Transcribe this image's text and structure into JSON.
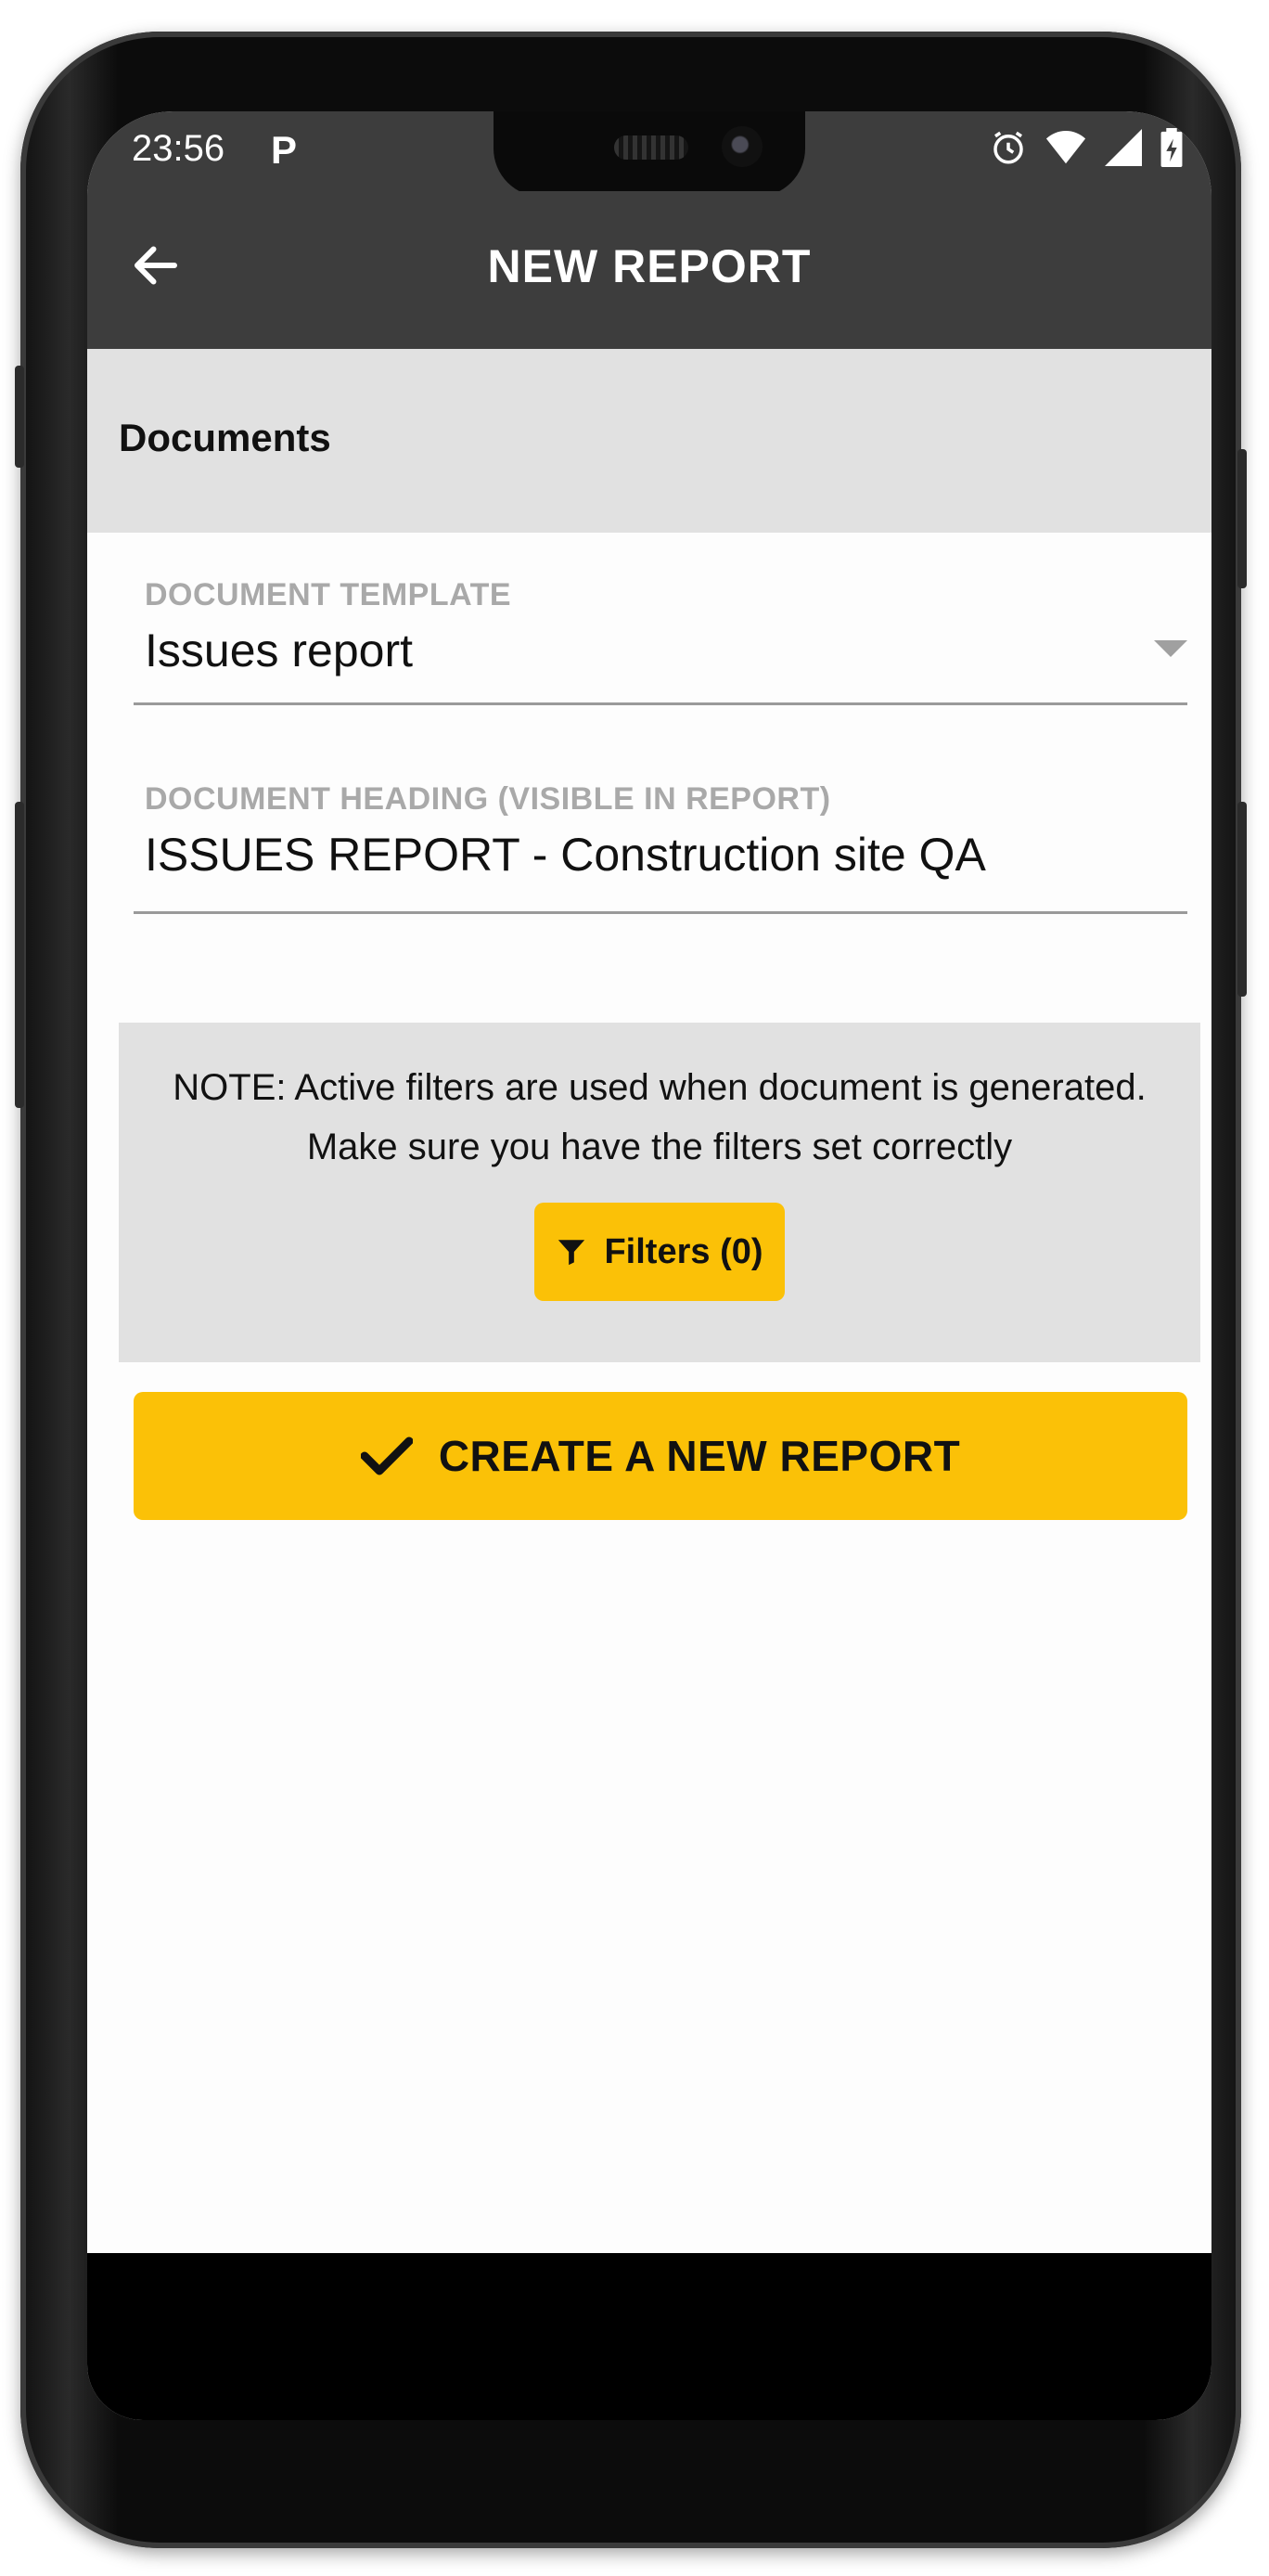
{
  "status_bar": {
    "time": "23:56",
    "notification_icon": "parking-p-icon",
    "icons": [
      "alarm-icon",
      "wifi-icon",
      "cell-signal-icon",
      "battery-charging-icon"
    ]
  },
  "app_bar": {
    "title": "NEW REPORT",
    "back_icon": "arrow-left-icon"
  },
  "section": {
    "title": "Documents"
  },
  "form": {
    "template": {
      "label": "DOCUMENT TEMPLATE",
      "value": "Issues report"
    },
    "heading": {
      "label": "DOCUMENT HEADING (VISIBLE IN REPORT)",
      "value": "ISSUES REPORT - Construction site QA"
    }
  },
  "note": {
    "text": "NOTE: Active filters are used when document is generated. Make sure you have the filters set correctly",
    "filters_button_label": "Filters (0)",
    "filters_icon": "filter-icon"
  },
  "create_button": {
    "label": "CREATE A NEW REPORT",
    "icon": "checkmark-icon"
  },
  "colors": {
    "accent": "#fbc107",
    "app_bar": "#3d3d3d",
    "section_bg": "#e1e1e1",
    "label_gray": "#a9a9a9"
  }
}
